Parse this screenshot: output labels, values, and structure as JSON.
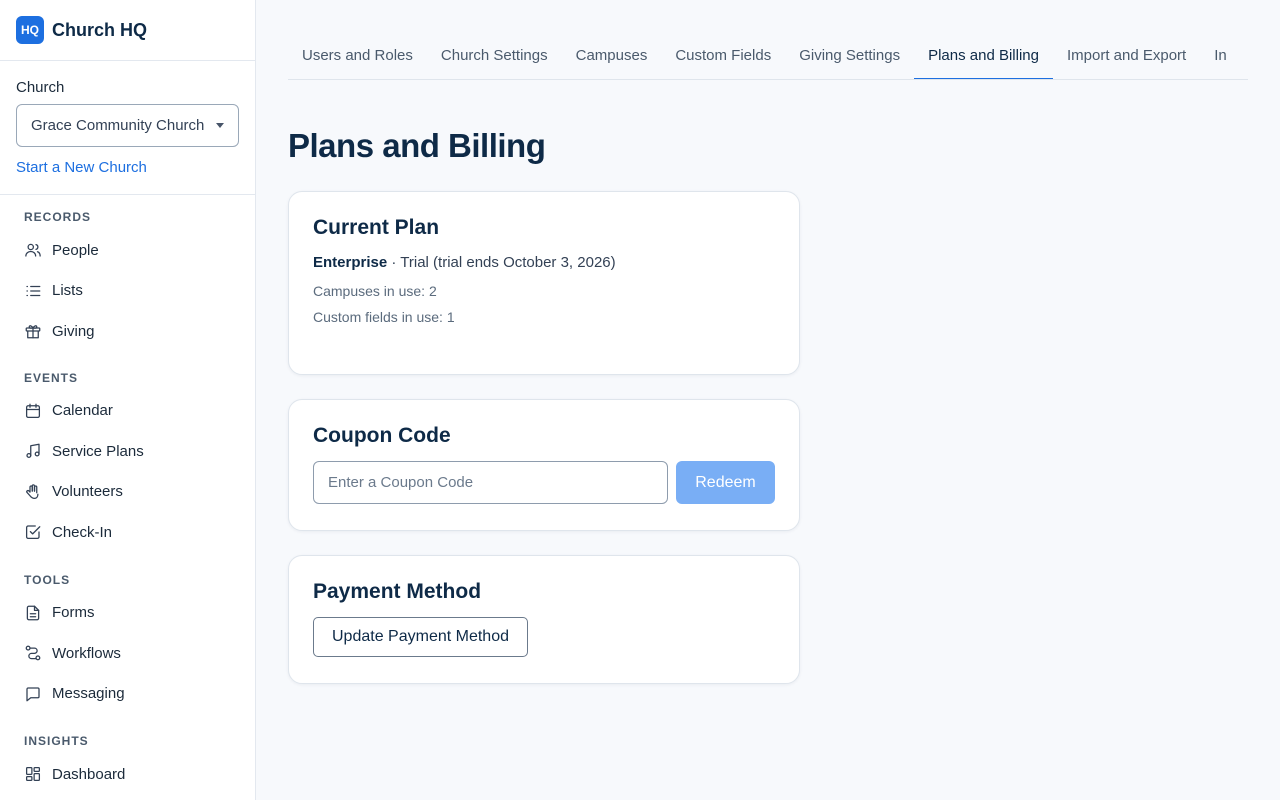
{
  "brand": {
    "logo_text": "HQ",
    "name": "Church HQ"
  },
  "church": {
    "label": "Church",
    "selected": "Grace Community Church",
    "new_church_link": "Start a New Church"
  },
  "nav": {
    "records": {
      "heading": "RECORDS",
      "items": [
        {
          "label": "People",
          "icon": "people-icon"
        },
        {
          "label": "Lists",
          "icon": "list-icon"
        },
        {
          "label": "Giving",
          "icon": "gift-icon"
        }
      ]
    },
    "events": {
      "heading": "EVENTS",
      "items": [
        {
          "label": "Calendar",
          "icon": "calendar-icon"
        },
        {
          "label": "Service Plans",
          "icon": "music-icon"
        },
        {
          "label": "Volunteers",
          "icon": "hand-icon"
        },
        {
          "label": "Check-In",
          "icon": "check-square-icon"
        }
      ]
    },
    "tools": {
      "heading": "TOOLS",
      "items": [
        {
          "label": "Forms",
          "icon": "document-icon"
        },
        {
          "label": "Workflows",
          "icon": "workflow-icon"
        },
        {
          "label": "Messaging",
          "icon": "message-icon"
        }
      ]
    },
    "insights": {
      "heading": "INSIGHTS",
      "items": [
        {
          "label": "Dashboard",
          "icon": "dashboard-icon"
        }
      ]
    }
  },
  "tabs": [
    {
      "label": "Users and Roles"
    },
    {
      "label": "Church Settings"
    },
    {
      "label": "Campuses"
    },
    {
      "label": "Custom Fields"
    },
    {
      "label": "Giving Settings"
    },
    {
      "label": "Plans and Billing",
      "active": true
    },
    {
      "label": "Import and Export"
    },
    {
      "label": "In"
    }
  ],
  "page": {
    "title": "Plans and Billing"
  },
  "current_plan": {
    "title": "Current Plan",
    "plan_name": "Enterprise",
    "plan_status": " · Trial (trial ends October 3, 2026)",
    "campuses": "Campuses in use: 2",
    "custom_fields": "Custom fields in use: 1"
  },
  "coupon": {
    "title": "Coupon Code",
    "placeholder": "Enter a Coupon Code",
    "button": "Redeem"
  },
  "payment": {
    "title": "Payment Method",
    "button": "Update Payment Method"
  },
  "colors": {
    "accent": "#1d6fe0",
    "redeem_disabled": "#79aef5",
    "heading": "#0e2a47"
  }
}
